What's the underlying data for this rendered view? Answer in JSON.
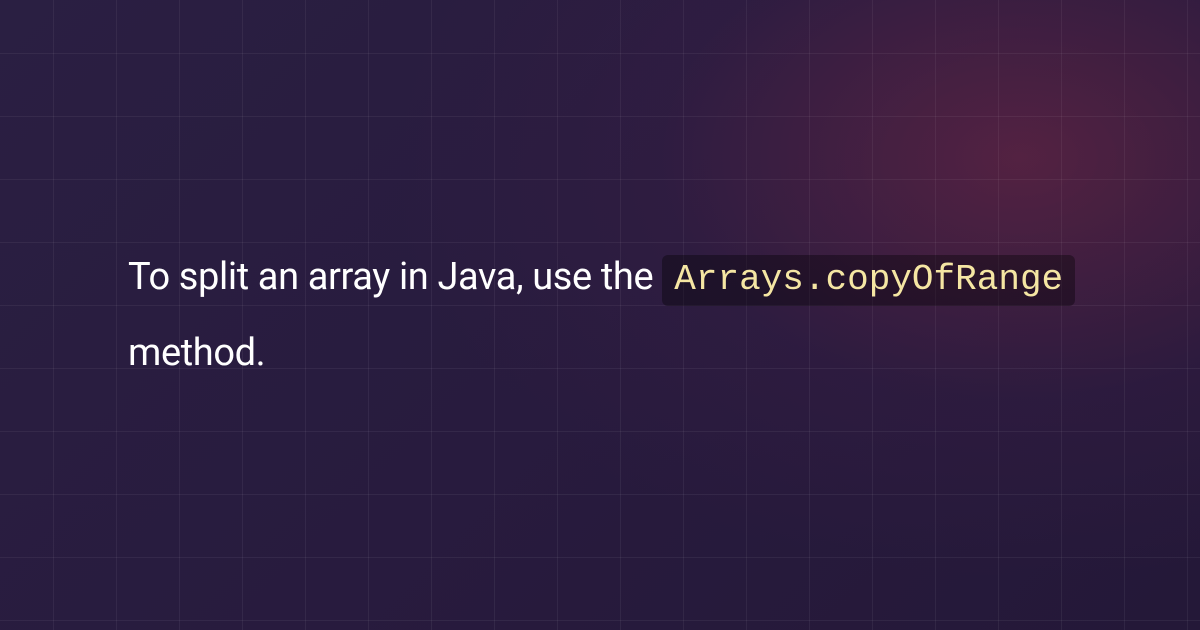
{
  "content": {
    "text_before": "To split an array in Java, use the ",
    "code": "Arrays.copyOfRange",
    "text_after": " method."
  },
  "colors": {
    "background_base": "#281b3e",
    "background_accent": "#5a2843",
    "grid_line": "rgba(255,255,255,0.055)",
    "text": "#ffffff",
    "code_text": "#f5e6a3",
    "code_bg": "rgba(0,0,0,0.35)"
  }
}
